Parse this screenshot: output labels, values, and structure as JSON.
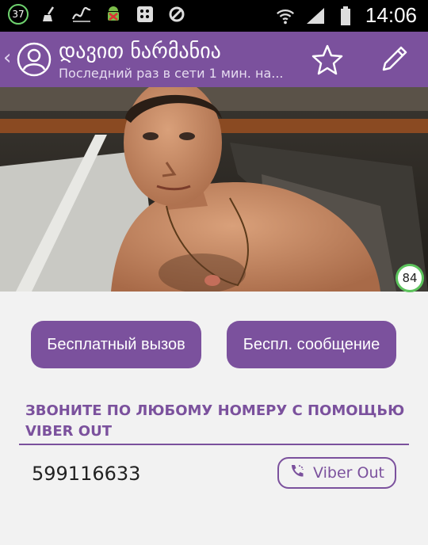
{
  "statusbar": {
    "badge_count": "37",
    "time": "14:06",
    "icons": [
      "broom-icon",
      "signature-icon",
      "android-icon",
      "blackberry-icon",
      "blocked-icon",
      "wifi-icon",
      "signal-icon",
      "battery-icon"
    ]
  },
  "header": {
    "title": "დავით ნარმანია",
    "subtitle": "Последний раз в сети 1 мин. на..."
  },
  "photo": {
    "counter": "84"
  },
  "actions": {
    "free_call": "Бесплатный вызов",
    "free_message": "Беспл. сообщение"
  },
  "viber_out": {
    "title": "ЗВОНИТЕ ПО ЛЮБОМУ НОМЕРУ С ПОМОЩЬЮ VIBER OUT",
    "phone": "599116633",
    "button_label": "Viber Out"
  },
  "colors": {
    "accent": "#7b519d",
    "background": "#f2f2f2",
    "statusbar": "#000000"
  }
}
